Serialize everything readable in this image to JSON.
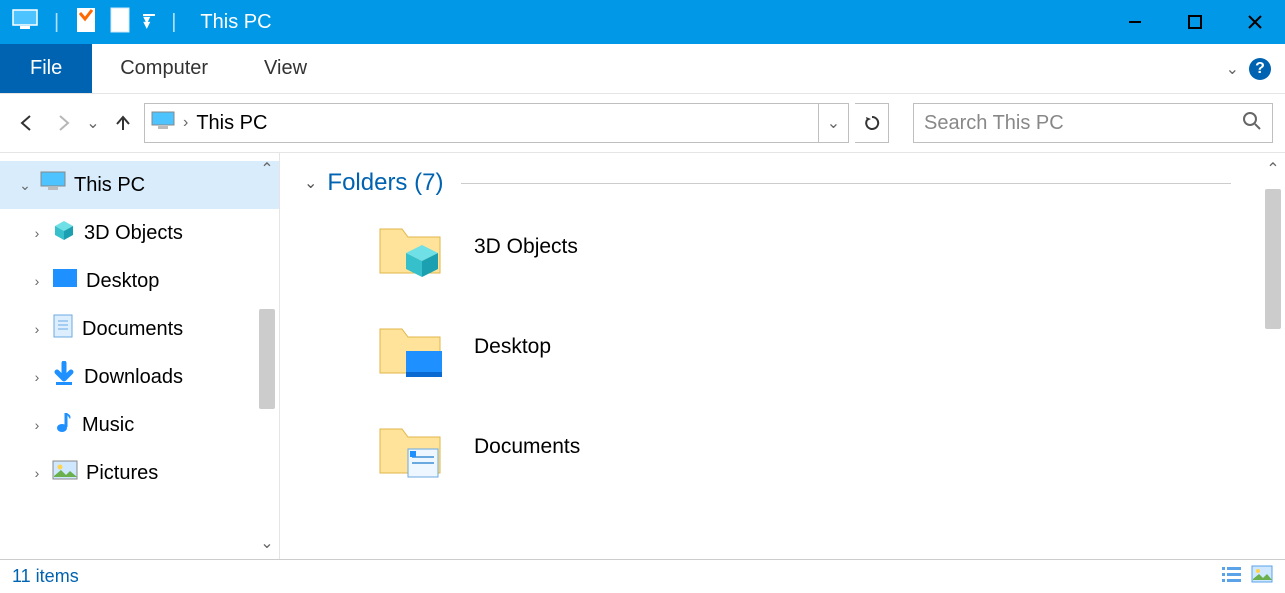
{
  "titlebar": {
    "title": "This PC"
  },
  "ribbon": {
    "file": "File",
    "tabs": [
      "Computer",
      "View"
    ]
  },
  "address": {
    "location": "This PC"
  },
  "search": {
    "placeholder": "Search This PC"
  },
  "tree": {
    "root": "This PC",
    "items": [
      "3D Objects",
      "Desktop",
      "Documents",
      "Downloads",
      "Music",
      "Pictures"
    ]
  },
  "content": {
    "group_label": "Folders (7)",
    "folders": [
      "3D Objects",
      "Desktop",
      "Documents"
    ]
  },
  "statusbar": {
    "count": "11 items"
  }
}
